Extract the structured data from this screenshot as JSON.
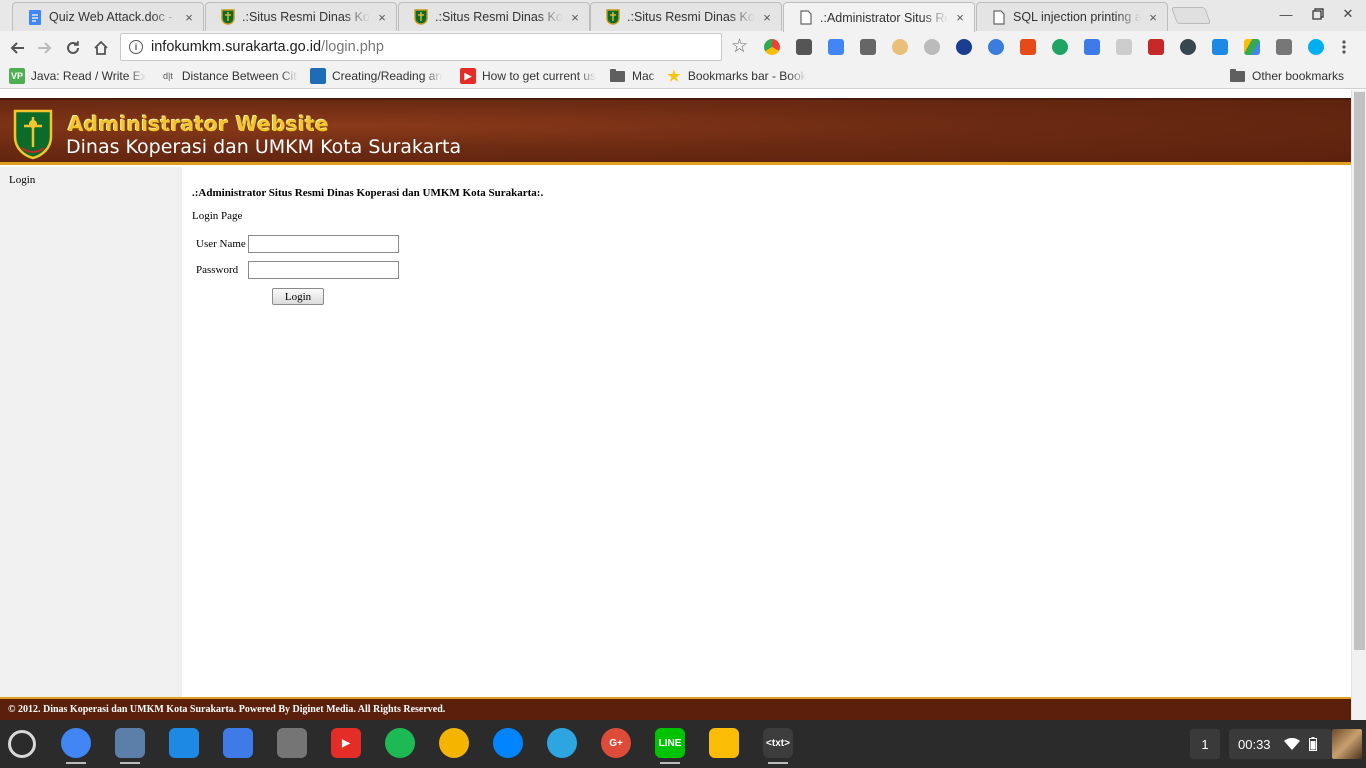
{
  "browser": {
    "tabs": [
      {
        "title": "Quiz Web Attack.doc - Go",
        "icon": "docs-icon",
        "active": false
      },
      {
        "title": ".:Situs Resmi Dinas Kope",
        "icon": "crest-icon",
        "active": false
      },
      {
        "title": ".:Situs Resmi Dinas Kope",
        "icon": "crest-icon",
        "active": false
      },
      {
        "title": ".:Situs Resmi Dinas Kope",
        "icon": "crest-icon",
        "active": false
      },
      {
        "title": ".:Administrator Situs Res",
        "icon": "page-icon",
        "active": true
      },
      {
        "title": "SQL injection printing all",
        "icon": "page-icon",
        "active": false
      }
    ],
    "tab_close_glyph": "×",
    "url": {
      "host": "infokumkm.surakarta.go.id",
      "path": "/login.php"
    },
    "bookmarks": [
      {
        "label": "Java: Read / Write Ex",
        "icon_text": "VP",
        "color": "#4caf50"
      },
      {
        "label": "Distance Between Citi",
        "icon_text": "d|t",
        "color": "#9e9e9e"
      },
      {
        "label": "Creating/Reading an",
        "icon_text": "",
        "color": "#1e6bb8"
      },
      {
        "label": "How to get current us",
        "icon_text": "▶",
        "color": "#e52d27"
      },
      {
        "label": "Mac",
        "icon_text": "",
        "color": "#5f5f5f"
      },
      {
        "label": "Bookmarks bar - Book",
        "icon_text": "★",
        "color": "#f5c518"
      }
    ],
    "other_bookmarks": "Other bookmarks"
  },
  "page": {
    "banner_title": "Administrator Website",
    "banner_subtitle": "Dinas Koperasi dan UMKM Kota Surakarta",
    "sidebar_link": "Login",
    "heading": ".:Administrator Situs Resmi Dinas Koperasi dan UMKM Kota Surakarta:.",
    "subheading": "Login Page",
    "username_label": "User Name",
    "username_value": "",
    "password_label": "Password",
    "password_value": "",
    "login_button": "Login",
    "footer": "© 2012. Dinas Koperasi dan UMKM Kota Surakarta. Powered By Diginet Media. All Rights Reserved."
  },
  "shelf": {
    "apps": [
      {
        "name": "chrome-icon",
        "color": "#4285f4",
        "text": ""
      },
      {
        "name": "chrome-app-icon",
        "color": "#5b7fa8",
        "text": ""
      },
      {
        "name": "files-icon",
        "color": "#1e88e5",
        "text": ""
      },
      {
        "name": "inbox-icon",
        "color": "#3f7be8",
        "text": ""
      },
      {
        "name": "calendar-icon",
        "color": "#757575",
        "text": ""
      },
      {
        "name": "youtube-icon",
        "color": "#e52d27",
        "text": "▶"
      },
      {
        "name": "spotify-icon",
        "color": "#1db954",
        "text": ""
      },
      {
        "name": "photos-icon",
        "color": "#f4b400",
        "text": ""
      },
      {
        "name": "messenger-icon",
        "color": "#0084ff",
        "text": ""
      },
      {
        "name": "telegram-icon",
        "color": "#2ca5e0",
        "text": ""
      },
      {
        "name": "google-plus-icon",
        "color": "#dd4b39",
        "text": "G+"
      },
      {
        "name": "line-icon",
        "color": "#00c300",
        "text": "LINE"
      },
      {
        "name": "keep-icon",
        "color": "#fbbc05",
        "text": ""
      },
      {
        "name": "text-editor-icon",
        "color": "#3c3c3c",
        "text": "<txt>"
      }
    ],
    "workspace": "1",
    "time": "00:33"
  }
}
